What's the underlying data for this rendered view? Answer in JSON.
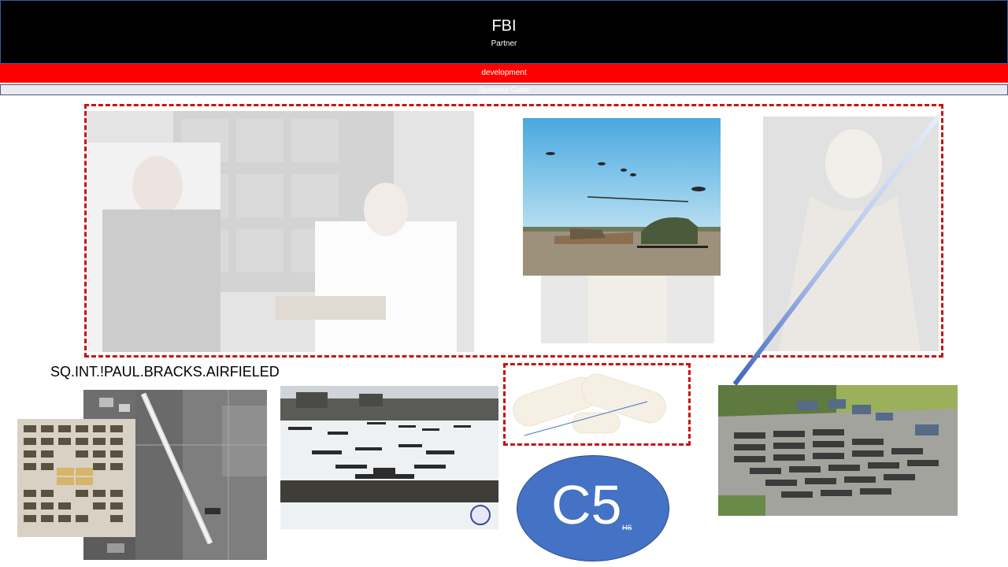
{
  "header": {
    "title": "FBI",
    "subtitle": "Partner"
  },
  "red_bar": {
    "label": "development"
  },
  "grey_bar": {
    "label": "Speeking Guide"
  },
  "caption": {
    "text": "SQ.INT.!PAUL.BRACKS.AIRFIELED"
  },
  "badge": {
    "main": "C5",
    "small": "HS"
  },
  "colors": {
    "header_bg": "#000000",
    "banner": "#ff0000",
    "dash": "#cc1111",
    "badge": "#4472c4"
  }
}
